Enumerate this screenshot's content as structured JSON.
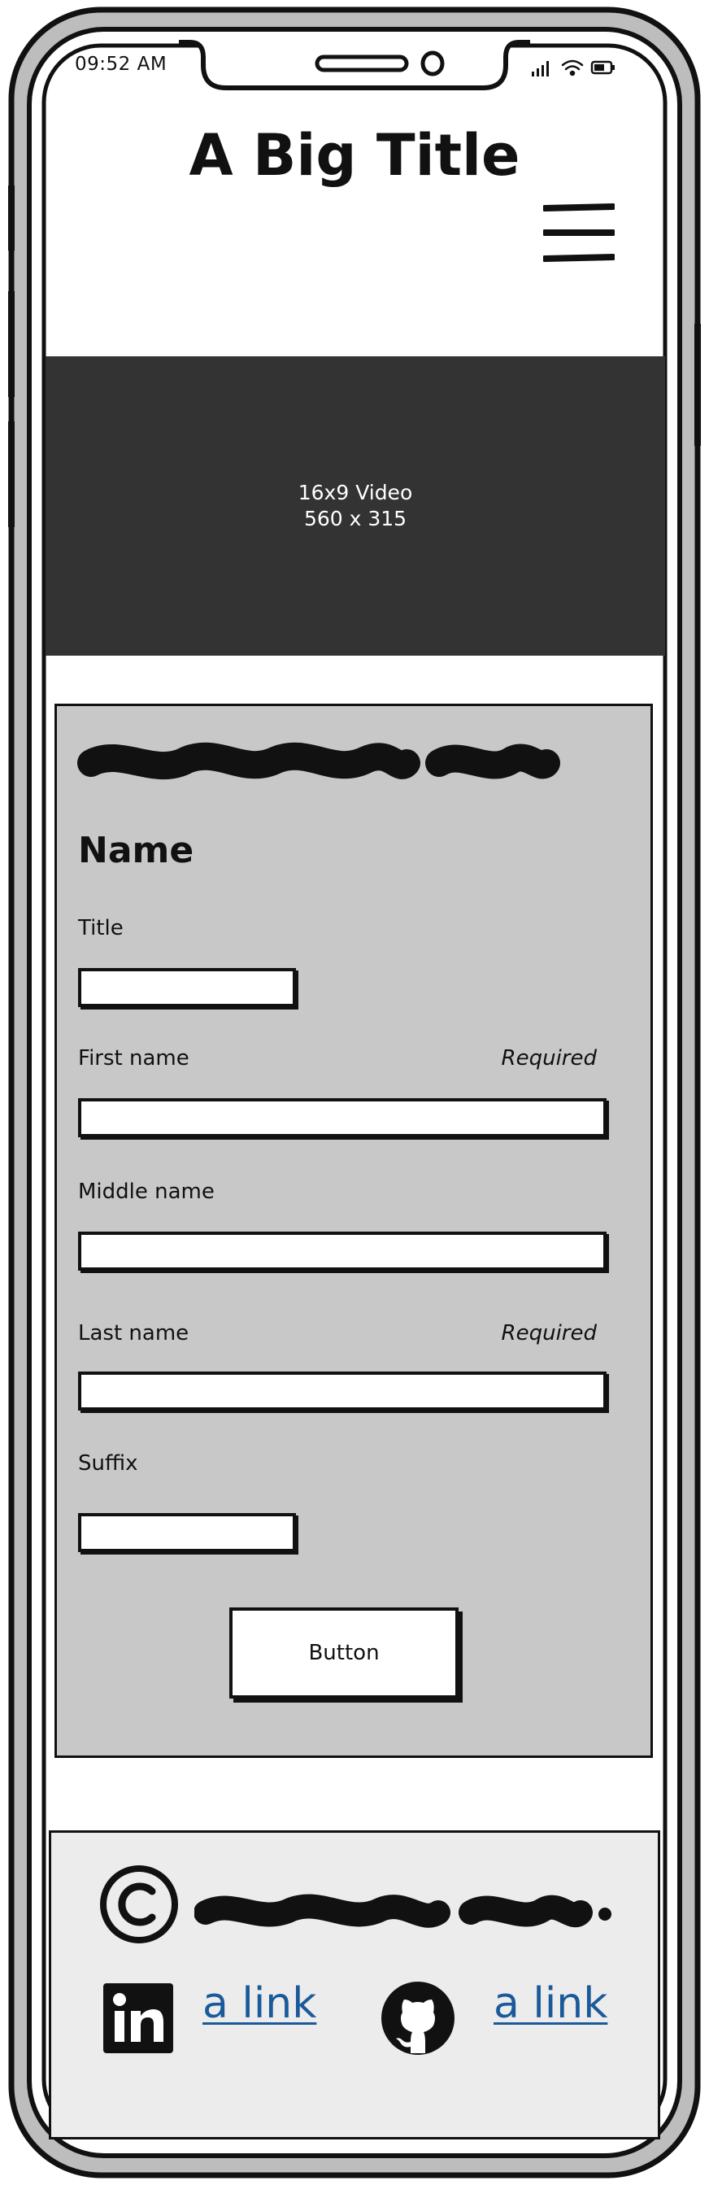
{
  "status_bar": {
    "time": "09:52 AM"
  },
  "header": {
    "title": "A Big Title",
    "menu_icon": "hamburger-menu-icon"
  },
  "video": {
    "label": "16x9 Video",
    "size": "560 x 315"
  },
  "form": {
    "heading": "Name",
    "fields": [
      {
        "label": "Title",
        "required": ""
      },
      {
        "label": "First name",
        "required": "Required"
      },
      {
        "label": "Middle name",
        "required": ""
      },
      {
        "label": "Last name",
        "required": "Required"
      },
      {
        "label": "Suffix",
        "required": ""
      }
    ],
    "button_label": "Button"
  },
  "footer": {
    "links": [
      {
        "icon": "linkedin-icon",
        "label": "a link"
      },
      {
        "icon": "github-icon",
        "label": "a link"
      }
    ]
  },
  "colors": {
    "video_bg": "#333333",
    "form_bg": "#c8c8c8",
    "footer_bg": "#ececec",
    "link": "#1a5a9a"
  }
}
